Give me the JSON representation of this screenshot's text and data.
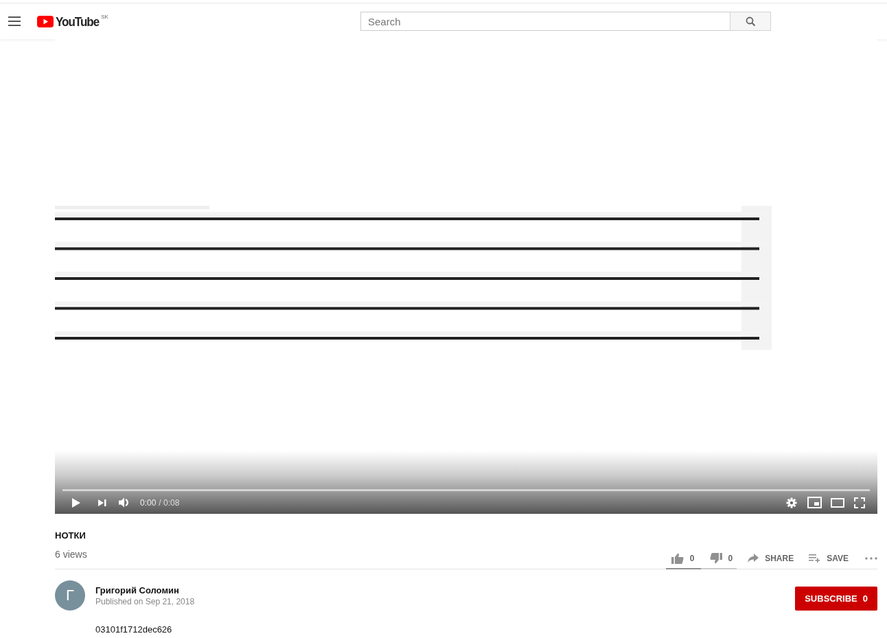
{
  "header": {
    "logo": "YouTube",
    "region": "SK",
    "search": {
      "placeholder": "Search"
    }
  },
  "player": {
    "current_time": "0:00",
    "duration": "/ 0:08"
  },
  "video": {
    "title": "НОТКИ",
    "views": "6 views",
    "actions": [
      {
        "kind": "like",
        "label": "0"
      },
      {
        "kind": "dislike",
        "label": "0"
      },
      {
        "kind": "share",
        "label": "SHARE"
      },
      {
        "kind": "save",
        "label": "SAVE"
      },
      {
        "kind": "more"
      }
    ],
    "sentiment": {
      "level": 0.5
    }
  },
  "channel": {
    "avatar_letter": "Г",
    "name": "Григорий Соломин",
    "published": "Published on Sep 21, 2018",
    "subscribe": "SUBSCRIBE",
    "subscribers": "0"
  },
  "description": "03101f1712dec626"
}
